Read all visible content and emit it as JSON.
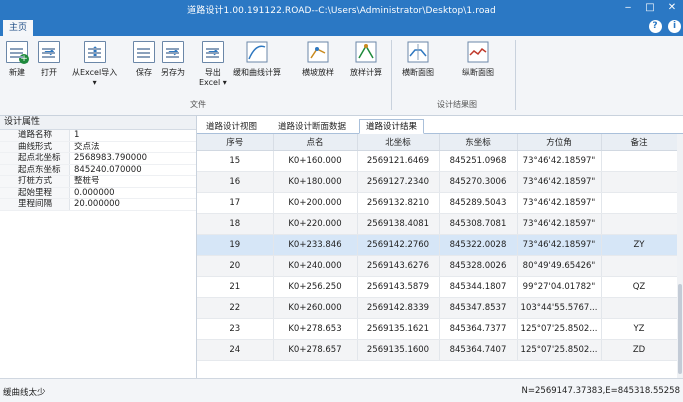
{
  "window": {
    "title": "道路设计1.00.191122.ROAD--C:\\Users\\Administrator\\Desktop\\1.road",
    "minimize": "‒",
    "maximize": "□",
    "close": "✕"
  },
  "menu": {
    "home_tab": "主页",
    "help": "?",
    "info": "i"
  },
  "ribbon": {
    "buttons": [
      {
        "label": "新建",
        "icon": "new-file-icon"
      },
      {
        "label": "打开",
        "icon": "open-file-icon"
      },
      {
        "label": "从Excel导入",
        "sub": "▾",
        "icon": "import-excel-icon"
      },
      {
        "label": "保存",
        "icon": "save-icon"
      },
      {
        "label": "另存为",
        "icon": "save-as-icon"
      },
      {
        "label": "导出",
        "sub": "Excel ▾",
        "icon": "export-icon"
      },
      {
        "label": "缓和曲线计算",
        "icon": "transition-curve-icon"
      },
      {
        "label": "横坡放样",
        "icon": "cross-slope-icon"
      },
      {
        "label": "放样计算",
        "icon": "stakeout-calc-icon"
      },
      {
        "label": "横断面图",
        "icon": "cross-section-icon"
      },
      {
        "label": "纵断面图",
        "icon": "profile-icon"
      }
    ],
    "groups": {
      "file": "文件",
      "results": "设计结果图"
    }
  },
  "properties": {
    "header": "设计属性",
    "rows": [
      {
        "key": "道路名称",
        "value": "1"
      },
      {
        "key": "曲线形式",
        "value": "交点法"
      },
      {
        "key": "起点北坐标",
        "value": "2568983.790000"
      },
      {
        "key": "起点东坐标",
        "value": "845240.070000"
      },
      {
        "key": "打桩方式",
        "value": "整桩号"
      },
      {
        "key": "起始里程",
        "value": "0.000000"
      },
      {
        "key": "里程间隔",
        "value": "20.000000"
      }
    ]
  },
  "subtabs": [
    "道路设计视图",
    "道路设计断面数据",
    "道路设计结果"
  ],
  "table": {
    "columns": [
      "序号",
      "点名",
      "北坐标",
      "东坐标",
      "方位角",
      "备注"
    ],
    "rows": [
      [
        "15",
        "K0+160.000",
        "2569121.6469",
        "845251.0968",
        "73°46'42.18597\"",
        ""
      ],
      [
        "16",
        "K0+180.000",
        "2569127.2340",
        "845270.3006",
        "73°46'42.18597\"",
        ""
      ],
      [
        "17",
        "K0+200.000",
        "2569132.8210",
        "845289.5043",
        "73°46'42.18597\"",
        ""
      ],
      [
        "18",
        "K0+220.000",
        "2569138.4081",
        "845308.7081",
        "73°46'42.18597\"",
        ""
      ],
      [
        "19",
        "K0+233.846",
        "2569142.2760",
        "845322.0028",
        "73°46'42.18597\"",
        "ZY"
      ],
      [
        "20",
        "K0+240.000",
        "2569143.6276",
        "845328.0026",
        "80°49'49.65426\"",
        ""
      ],
      [
        "21",
        "K0+256.250",
        "2569143.5879",
        "845344.1807",
        "99°27'04.01782\"",
        "QZ"
      ],
      [
        "22",
        "K0+260.000",
        "2569142.8339",
        "845347.8537",
        "103°44'55.5767...",
        ""
      ],
      [
        "23",
        "K0+278.653",
        "2569135.1621",
        "845364.7377",
        "125°07'25.8502...",
        "YZ"
      ],
      [
        "24",
        "K0+278.657",
        "2569135.1600",
        "845364.7407",
        "125°07'25.8502...",
        "ZD"
      ]
    ]
  },
  "status": {
    "left": "缓曲线太少",
    "right": "N=2569147.37383,E=845318.55258"
  }
}
